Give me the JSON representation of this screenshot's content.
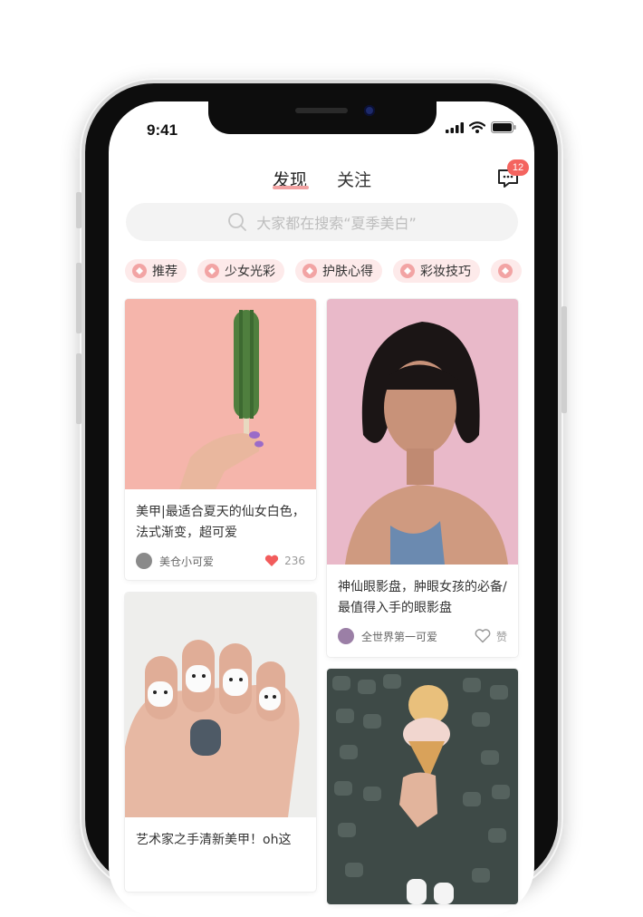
{
  "status": {
    "time": "9:41"
  },
  "nav": {
    "tabs": [
      {
        "label": "发现",
        "active": true
      },
      {
        "label": "关注",
        "active": false
      }
    ],
    "message_badge": "12"
  },
  "search": {
    "placeholder": "大家都在搜索“夏季美白”"
  },
  "categories": [
    "推荐",
    "少女光彩",
    "护肤心得",
    "彩妆技巧"
  ],
  "feed": {
    "posts": [
      {
        "title": "美甲|最适合夏天的仙女白色，法式渐变，超可爱",
        "author": "美仓小可爱",
        "likes": "236",
        "liked": true,
        "image": "cactus-popsicle-photo"
      },
      {
        "title": "神仙眼影盘，肿眼女孩的必备/最值得入手的眼影盘",
        "author": "全世界第一可爱",
        "likes": "赞",
        "liked": false,
        "image": "woman-portrait-photo"
      },
      {
        "title": "艺术家之手清新美甲！oh这",
        "image": "totoro-nails-photo"
      },
      {
        "title": "",
        "image": "ice-cream-cone-photo"
      }
    ]
  },
  "colors": {
    "accent": "#f4645f",
    "chip_bg": "#fdeaea",
    "heart": "#f25c5c"
  }
}
